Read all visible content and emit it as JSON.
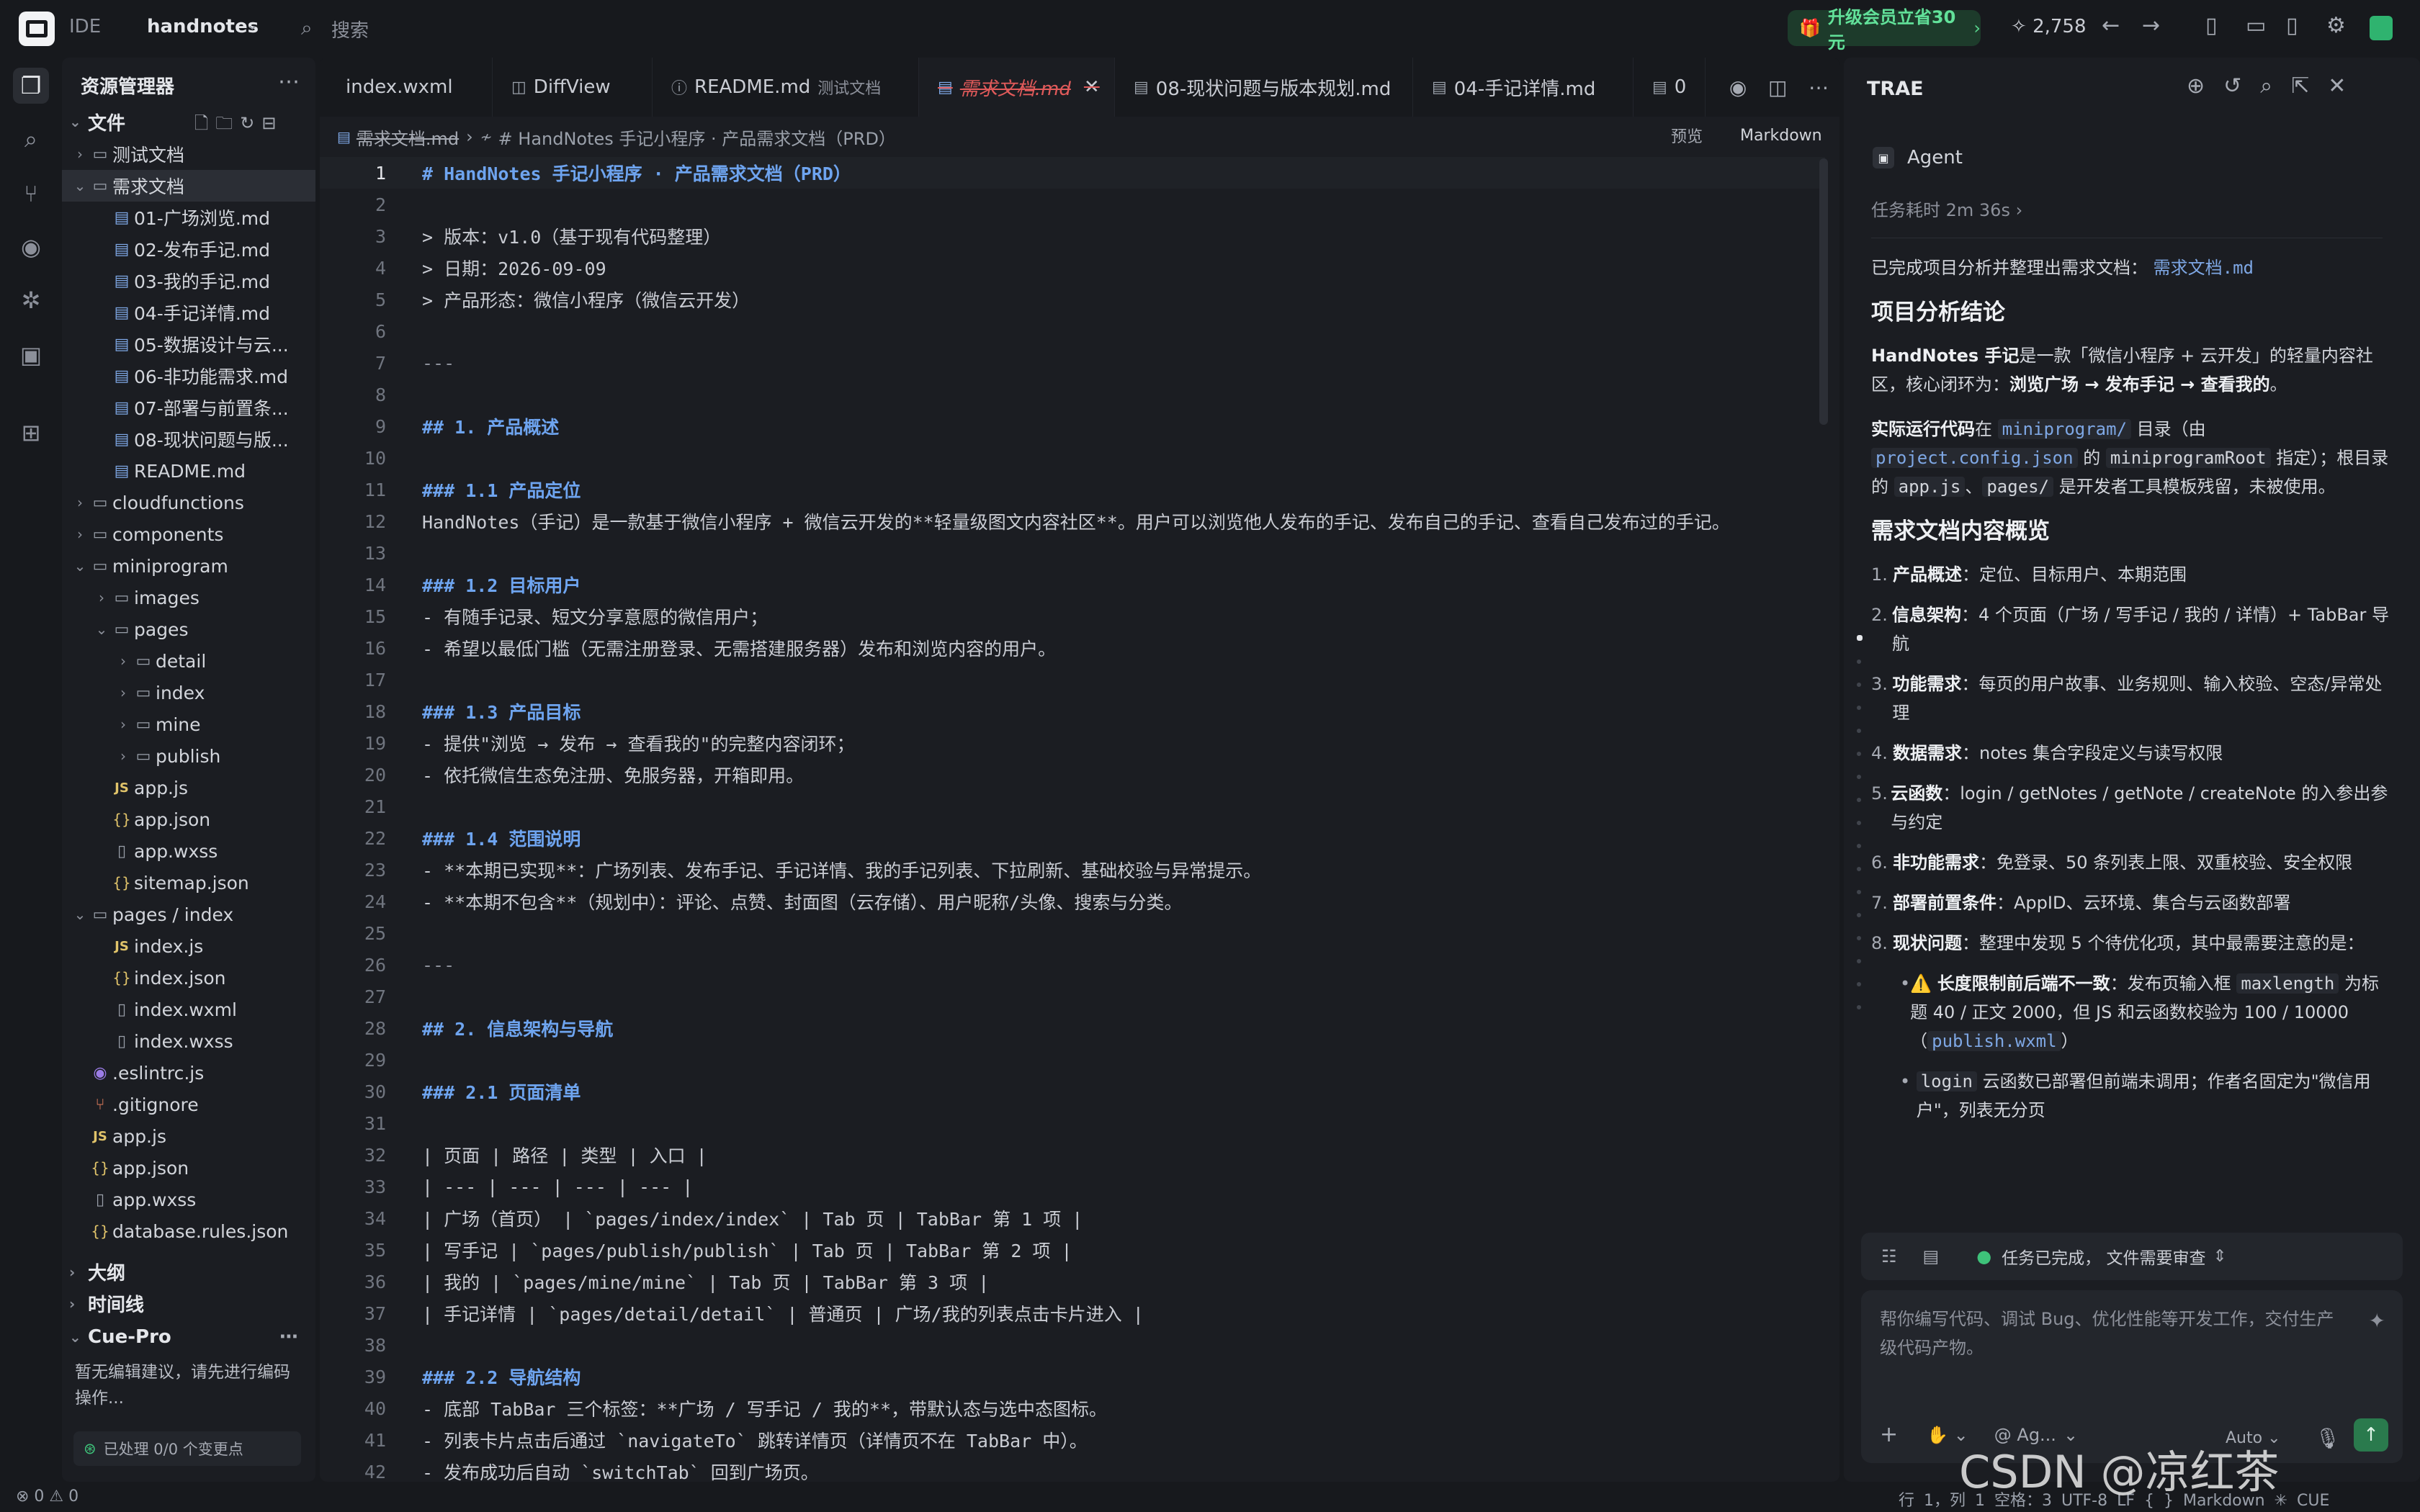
{
  "topbar": {
    "ide": "IDE",
    "project": "handnotes",
    "search_placeholder": "搜索",
    "promo": "升级会员立省30元",
    "stars": "2,758"
  },
  "explorer": {
    "title": "资源管理器",
    "section": "文件",
    "tree": [
      {
        "indent": 0,
        "chev": "›",
        "icon": "folder",
        "label": "测试文档"
      },
      {
        "indent": 0,
        "chev": "⌄",
        "icon": "folder",
        "label": "需求文档",
        "selected": true
      },
      {
        "indent": 1,
        "chev": "",
        "icon": "md",
        "label": "01-广场浏览.md"
      },
      {
        "indent": 1,
        "chev": "",
        "icon": "md",
        "label": "02-发布手记.md"
      },
      {
        "indent": 1,
        "chev": "",
        "icon": "md",
        "label": "03-我的手记.md"
      },
      {
        "indent": 1,
        "chev": "",
        "icon": "md",
        "label": "04-手记详情.md"
      },
      {
        "indent": 1,
        "chev": "",
        "icon": "md",
        "label": "05-数据设计与云..."
      },
      {
        "indent": 1,
        "chev": "",
        "icon": "md",
        "label": "06-非功能需求.md"
      },
      {
        "indent": 1,
        "chev": "",
        "icon": "md",
        "label": "07-部署与前置条..."
      },
      {
        "indent": 1,
        "chev": "",
        "icon": "md",
        "label": "08-现状问题与版..."
      },
      {
        "indent": 1,
        "chev": "",
        "icon": "md",
        "label": "README.md"
      },
      {
        "indent": 0,
        "chev": "›",
        "icon": "folder",
        "label": "cloudfunctions"
      },
      {
        "indent": 0,
        "chev": "›",
        "icon": "folder",
        "label": "components"
      },
      {
        "indent": 0,
        "chev": "⌄",
        "icon": "folder",
        "label": "miniprogram"
      },
      {
        "indent": 1,
        "chev": "›",
        "icon": "folder",
        "label": "images"
      },
      {
        "indent": 1,
        "chev": "⌄",
        "icon": "folder",
        "label": "pages"
      },
      {
        "indent": 2,
        "chev": "›",
        "icon": "folder",
        "label": "detail"
      },
      {
        "indent": 2,
        "chev": "›",
        "icon": "folder",
        "label": "index"
      },
      {
        "indent": 2,
        "chev": "›",
        "icon": "folder",
        "label": "mine"
      },
      {
        "indent": 2,
        "chev": "›",
        "icon": "folder",
        "label": "publish"
      },
      {
        "indent": 1,
        "chev": "",
        "icon": "js",
        "label": "app.js"
      },
      {
        "indent": 1,
        "chev": "",
        "icon": "json",
        "label": "app.json"
      },
      {
        "indent": 1,
        "chev": "",
        "icon": "file",
        "label": "app.wxss"
      },
      {
        "indent": 1,
        "chev": "",
        "icon": "json",
        "label": "sitemap.json"
      },
      {
        "indent": 0,
        "chev": "⌄",
        "icon": "folder",
        "label": "pages / index"
      },
      {
        "indent": 1,
        "chev": "",
        "icon": "js",
        "label": "index.js"
      },
      {
        "indent": 1,
        "chev": "",
        "icon": "json",
        "label": "index.json"
      },
      {
        "indent": 1,
        "chev": "",
        "icon": "file",
        "label": "index.wxml"
      },
      {
        "indent": 1,
        "chev": "",
        "icon": "file",
        "label": "index.wxss"
      },
      {
        "indent": 0,
        "chev": "",
        "icon": "dot",
        "label": ".eslintrc.js"
      },
      {
        "indent": 0,
        "chev": "",
        "icon": "git",
        "label": ".gitignore"
      },
      {
        "indent": 0,
        "chev": "",
        "icon": "js",
        "label": "app.js"
      },
      {
        "indent": 0,
        "chev": "",
        "icon": "json",
        "label": "app.json"
      },
      {
        "indent": 0,
        "chev": "",
        "icon": "file",
        "label": "app.wxss"
      },
      {
        "indent": 0,
        "chev": "",
        "icon": "json",
        "label": "database.rules.json"
      }
    ],
    "outline": "大纲",
    "timeline": "时间线",
    "cue_title": "Cue-Pro",
    "cue_text": "暂无编辑建议，请先进行编码操作...",
    "cue_status": "已处理 0/0 个变更点"
  },
  "editor": {
    "tabs": [
      {
        "label": "index.wxml",
        "sub": ""
      },
      {
        "label": "DiffView",
        "sub": ""
      },
      {
        "label": "README.md",
        "sub": "测试文档"
      },
      {
        "label": "需求文档.md",
        "sub": "",
        "active": true
      },
      {
        "label": "08-现状问题与版本规划.md",
        "sub": ""
      },
      {
        "label": "04-手记详情.md",
        "sub": ""
      },
      {
        "label": "0",
        "sub": ""
      }
    ],
    "breadcrumb_file": "需求文档.md",
    "breadcrumb_path": "# HandNotes 手记小程序 · 产品需求文档（PRD）",
    "preview": "预览",
    "markdown": "Markdown",
    "lines": [
      {
        "n": "1",
        "t": "# HandNotes 手记小程序 · 产品需求文档（PRD）",
        "k": "h"
      },
      {
        "n": "2",
        "t": "",
        "k": ""
      },
      {
        "n": "3",
        "t": "> 版本：v1.0（基于现有代码整理）",
        "k": "q"
      },
      {
        "n": "4",
        "t": "> 日期：2026-09-09",
        "k": "q"
      },
      {
        "n": "5",
        "t": "> 产品形态：微信小程序（微信云开发）",
        "k": "q"
      },
      {
        "n": "6",
        "t": "",
        "k": ""
      },
      {
        "n": "7",
        "t": "---",
        "k": "hr"
      },
      {
        "n": "8",
        "t": "",
        "k": ""
      },
      {
        "n": "9",
        "t": "## 1. 产品概述",
        "k": "h"
      },
      {
        "n": "10",
        "t": "",
        "k": ""
      },
      {
        "n": "11",
        "t": "### 1.1 产品定位",
        "k": "h"
      },
      {
        "n": "12",
        "t": "HandNotes（手记）是一款基于微信小程序 + 微信云开发的**轻量级图文内容社区**。用户可以浏览他人发布的手记、发布自己的手记、查看自己发布过的手记。",
        "k": ""
      },
      {
        "n": "13",
        "t": "",
        "k": ""
      },
      {
        "n": "14",
        "t": "### 1.2 目标用户",
        "k": "h"
      },
      {
        "n": "15",
        "t": "- 有随手记录、短文分享意愿的微信用户；",
        "k": ""
      },
      {
        "n": "16",
        "t": "- 希望以最低门槛（无需注册登录、无需搭建服务器）发布和浏览内容的用户。",
        "k": ""
      },
      {
        "n": "17",
        "t": "",
        "k": ""
      },
      {
        "n": "18",
        "t": "### 1.3 产品目标",
        "k": "h"
      },
      {
        "n": "19",
        "t": "- 提供\"浏览 → 发布 → 查看我的\"的完整内容闭环；",
        "k": ""
      },
      {
        "n": "20",
        "t": "- 依托微信生态免注册、免服务器，开箱即用。",
        "k": ""
      },
      {
        "n": "21",
        "t": "",
        "k": ""
      },
      {
        "n": "22",
        "t": "### 1.4 范围说明",
        "k": "h"
      },
      {
        "n": "23",
        "t": "- **本期已实现**：广场列表、发布手记、手记详情、我的手记列表、下拉刷新、基础校验与异常提示。",
        "k": ""
      },
      {
        "n": "24",
        "t": "- **本期不包含**（规划中）：评论、点赞、封面图（云存储）、用户昵称/头像、搜索与分类。",
        "k": ""
      },
      {
        "n": "25",
        "t": "",
        "k": ""
      },
      {
        "n": "26",
        "t": "---",
        "k": "hr"
      },
      {
        "n": "27",
        "t": "",
        "k": ""
      },
      {
        "n": "28",
        "t": "## 2. 信息架构与导航",
        "k": "h"
      },
      {
        "n": "29",
        "t": "",
        "k": ""
      },
      {
        "n": "30",
        "t": "### 2.1 页面清单",
        "k": "h"
      },
      {
        "n": "31",
        "t": "",
        "k": ""
      },
      {
        "n": "32",
        "t": "| 页面 | 路径 | 类型 | 入口 |",
        "k": ""
      },
      {
        "n": "33",
        "t": "| --- | --- | --- | --- |",
        "k": ""
      },
      {
        "n": "34",
        "t": "| 广场（首页） | `pages/index/index` | Tab 页 | TabBar 第 1 项 |",
        "k": ""
      },
      {
        "n": "35",
        "t": "| 写手记 | `pages/publish/publish` | Tab 页 | TabBar 第 2 项 |",
        "k": ""
      },
      {
        "n": "36",
        "t": "| 我的 | `pages/mine/mine` | Tab 页 | TabBar 第 3 项 |",
        "k": ""
      },
      {
        "n": "37",
        "t": "| 手记详情 | `pages/detail/detail` | 普通页 | 广场/我的列表点击卡片进入 |",
        "k": ""
      },
      {
        "n": "38",
        "t": "",
        "k": ""
      },
      {
        "n": "39",
        "t": "### 2.2 导航结构",
        "k": "h"
      },
      {
        "n": "40",
        "t": "- 底部 TabBar 三个标签：**广场 / 写手记 / 我的**，带默认态与选中态图标。",
        "k": ""
      },
      {
        "n": "41",
        "t": "- 列表卡片点击后通过 `navigateTo` 跳转详情页（详情页不在 TabBar 中）。",
        "k": ""
      },
      {
        "n": "42",
        "t": "- 发布成功后自动 `switchTab` 回到广场页。",
        "k": ""
      }
    ]
  },
  "trae": {
    "title": "TRAE",
    "agent": "Agent",
    "task_time": "任务耗时 2m 36s ›",
    "msg_intro": "已完成项目分析并整理出需求文档：",
    "msg_intro_link": "需求文档.md",
    "h_conclusion": "项目分析结论",
    "p1_b1": "HandNotes 手记",
    "p1_a": "是一款「微信小程序 + 云开发」的轻量内容社区，核心闭环为：",
    "p1_b2": "浏览广场 → 发布手记 → 查看我的",
    "p1_end": "。",
    "p2_b": "实际运行代码",
    "p2_a": "在",
    "p2_c1": "miniprogram/",
    "p2_b_txt": "目录（由",
    "p2_c2": "project.config.json",
    "p2_c_txt": "的",
    "p2_c3": "miniprogramRoot",
    "p2_d_txt": "指定）；根目录的",
    "p2_c4": "app.js",
    "p2_e_txt": "、",
    "p2_c5": "pages/",
    "p2_f_txt": "是开发者工具模板残留，未被使用。",
    "h_overview": "需求文档内容概览",
    "list": [
      {
        "n": "1.",
        "b": "产品概述",
        "t": "：定位、目标用户、本期范围"
      },
      {
        "n": "2.",
        "b": "信息架构",
        "t": "：4 个页面（广场 / 写手记 / 我的 / 详情）+ TabBar 导航"
      },
      {
        "n": "3.",
        "b": "功能需求",
        "t": "：每页的用户故事、业务规则、输入校验、空态/异常处理"
      },
      {
        "n": "4.",
        "b": "数据需求",
        "t": "：notes 集合字段定义与读写权限"
      },
      {
        "n": "5.",
        "b": "云函数",
        "t": "：login / getNotes / getNote / createNote 的入参出参与约定"
      },
      {
        "n": "6.",
        "b": "非功能需求",
        "t": "：免登录、50 条列表上限、双重校验、安全权限"
      },
      {
        "n": "7.",
        "b": "部署前置条件",
        "t": "：AppID、云环境、集合与云函数部署"
      },
      {
        "n": "8.",
        "b": "现状问题",
        "t": "：整理中发现 5 个待优化项，其中最需要注意的是："
      }
    ],
    "sub1_b": "长度限制前后端不一致",
    "sub1_t1": "：发布页输入框",
    "sub1_c1": "maxlength",
    "sub1_t2": "为标题 40 / 正文 2000，但 JS 和云函数校验为 100 / 10000（",
    "sub1_c2": "publish.wxml",
    "sub1_t3": "）",
    "sub2_c": "login",
    "sub2_t": "云函数已部署但前端未调用；作者名固定为\"微信用户\"，列表无分页",
    "status": "任务已完成， 文件需要审查",
    "input_placeholder": "帮你编写代码、调试 Bug、优化性能等开发工作，交付生产级代码产物。",
    "agent_select": "@ Ag...",
    "auto": "Auto"
  },
  "statusbar": {
    "left": "⊗ 0  ⚠ 0",
    "right": "行 1，列 1   空格：3   UTF-8   LF   { }   Markdown   ✳ CUE"
  },
  "watermark": "CSDN @凉红茶"
}
